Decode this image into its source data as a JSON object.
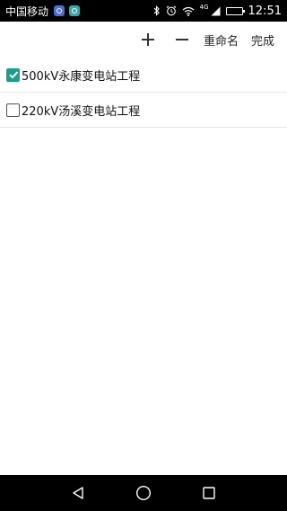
{
  "status_bar": {
    "carrier": "中国移动",
    "network_type": "4G",
    "time": "12:51",
    "battery_level": 0.9,
    "icons": [
      "app-notification-icon",
      "app-notification-icon",
      "bluetooth-icon",
      "alarm-icon",
      "wifi-icon",
      "signal-icon",
      "battery-icon"
    ]
  },
  "toolbar": {
    "add_icon": "plus-icon",
    "remove_icon": "minus-icon",
    "rename_label": "重命名",
    "done_label": "完成"
  },
  "projects": [
    {
      "label": "500kV永康变电站工程",
      "checked": true
    },
    {
      "label": "220kV汤溪变电站工程",
      "checked": false
    }
  ],
  "colors": {
    "accent": "#1e9e8a",
    "status_bar_bg": "#000000",
    "nav_bar_bg": "#000000",
    "divider": "#e6e6e6"
  },
  "nav_bar": {
    "icons": [
      "back-icon",
      "home-icon",
      "recents-icon"
    ]
  }
}
